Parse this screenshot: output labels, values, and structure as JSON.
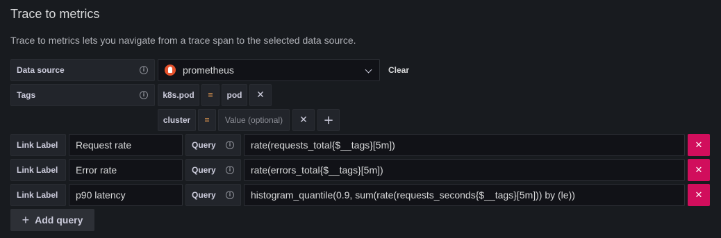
{
  "section": {
    "title": "Trace to metrics",
    "description": "Trace to metrics lets you navigate from a trace span to the selected data source."
  },
  "datasource": {
    "label": "Data source",
    "value": "prometheus",
    "clear_label": "Clear",
    "icon": "prometheus-logo"
  },
  "tags": {
    "label": "Tags",
    "rows": [
      {
        "key": "k8s.pod",
        "operator": "=",
        "value": "pod",
        "value_placeholder": ""
      },
      {
        "key": "cluster",
        "operator": "=",
        "value": "",
        "value_placeholder": "Value (optional)"
      }
    ]
  },
  "queries": [
    {
      "link_label_label": "Link Label",
      "link_label": "Request rate",
      "query_label": "Query",
      "query": "rate(requests_total{$__tags}[5m])"
    },
    {
      "link_label_label": "Link Label",
      "link_label": "Error rate",
      "query_label": "Query",
      "query": "rate(errors_total{$__tags}[5m])"
    },
    {
      "link_label_label": "Link Label",
      "link_label": "p90 latency",
      "query_label": "Query",
      "query": "histogram_quantile(0.9, sum(rate(requests_seconds{$__tags}[5m])) by (le))"
    }
  ],
  "add_query_label": "Add query",
  "colors": {
    "background": "#181b1f",
    "delete": "#d10e5c",
    "operator": "#f5a453",
    "prometheus": "#e6522c"
  }
}
